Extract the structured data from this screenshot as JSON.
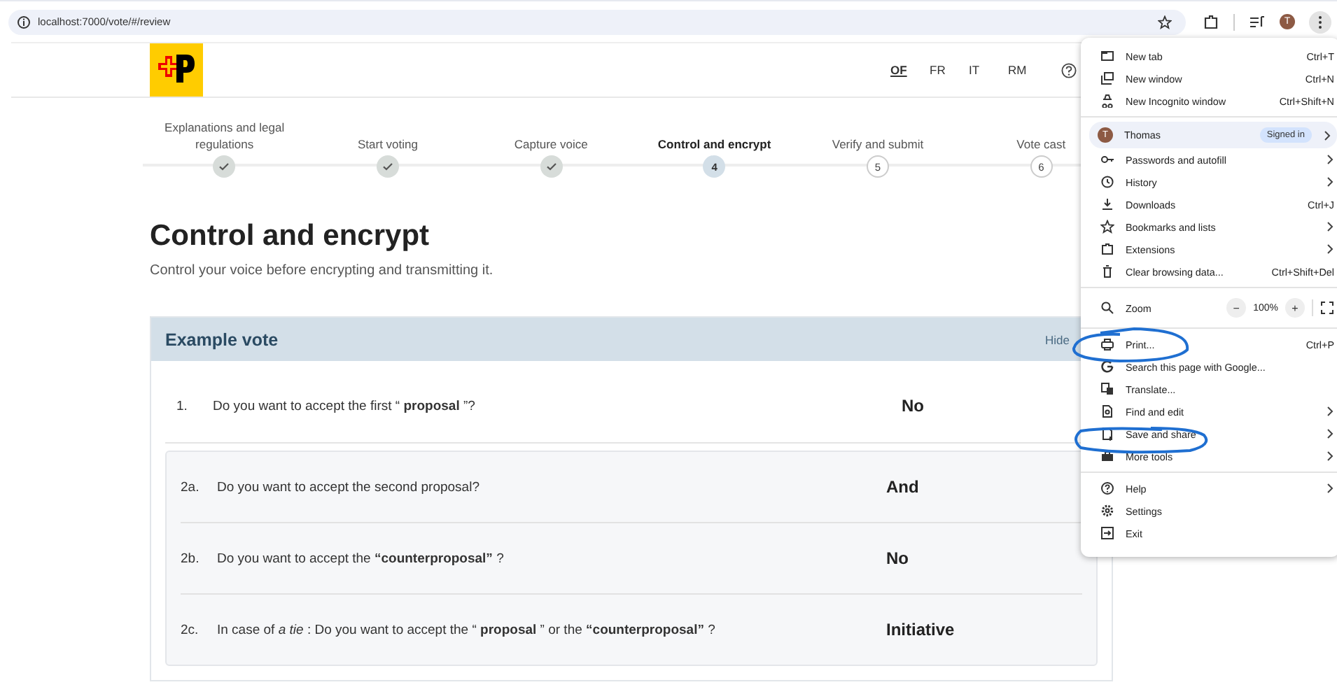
{
  "browser": {
    "url": "localhost:7000/vote/#/review",
    "profile_initial": "T"
  },
  "header": {
    "languages": [
      {
        "label": "OF",
        "selected": true
      },
      {
        "label": "FR",
        "selected": false
      },
      {
        "label": "IT",
        "selected": false
      },
      {
        "label": "RM",
        "selected": false
      }
    ]
  },
  "steps": [
    {
      "label": "Explanations and legal regulations",
      "done": true,
      "selected": false
    },
    {
      "label": "Start voting",
      "done": true,
      "selected": false
    },
    {
      "label": "Capture voice",
      "done": true,
      "selected": false
    },
    {
      "label": "Control and encrypt",
      "number": "4",
      "done": false,
      "selected": true
    },
    {
      "label": "Verify and submit",
      "number": "5",
      "done": false,
      "selected": false
    },
    {
      "label": "Vote cast",
      "number": "6",
      "done": false,
      "selected": false
    }
  ],
  "title": "Control and encrypt",
  "subtitle": "Control your voice before encrypting and transmitting it.",
  "vote": {
    "title": "Example vote",
    "toggle": "Hide",
    "items": [
      {
        "kind": "single",
        "number": "1.",
        "text": "Do you want to accept the first “ **proposal** ”?",
        "answer": "No"
      },
      {
        "kind": "group",
        "questions": [
          {
            "number": "2a.",
            "text": "Do you want to accept the second proposal?",
            "answer": "And"
          },
          {
            "number": "2b.",
            "text": "Do you want to accept the **“counterproposal”** ?",
            "answer": "No"
          },
          {
            "number": "2c.",
            "text": "In case of *a tie* : Do you want to accept the “ **proposal** ” or the **“counterproposal”** ?",
            "answer": "Initiative"
          }
        ]
      }
    ]
  },
  "menu": {
    "sections": [
      [
        {
          "label": "New tab",
          "shortcut": "Ctrl+T"
        },
        {
          "label": "New window",
          "shortcut": "Ctrl+N"
        },
        {
          "label": "New Incognito window",
          "shortcut": "Ctrl+Shift+N"
        }
      ],
      [
        {
          "kind": "profile",
          "initial": "T",
          "label": "Thomas",
          "badge": "Signed in",
          "submenu": true
        },
        {
          "label": "Passwords and autofill",
          "submenu": true
        },
        {
          "label": "History",
          "submenu": true
        },
        {
          "label": "Downloads",
          "shortcut": "Ctrl+J"
        },
        {
          "label": "Bookmarks and lists",
          "submenu": true
        },
        {
          "label": "Extensions",
          "submenu": true
        },
        {
          "label": "Clear browsing data...",
          "shortcut": "Ctrl+Shift+Del"
        }
      ],
      [
        {
          "kind": "zoom",
          "label": "Zoom",
          "minus": "−",
          "value": "100%",
          "plus": "+"
        }
      ],
      [
        {
          "label": "Print...",
          "shortcut": "Ctrl+P"
        },
        {
          "label": "Search this page with Google..."
        },
        {
          "label": "Translate..."
        },
        {
          "label": "Find and edit",
          "submenu": true
        },
        {
          "label": "Save and share",
          "submenu": true
        },
        {
          "label": "More tools",
          "submenu": true
        }
      ],
      [
        {
          "label": "Help",
          "submenu": true
        },
        {
          "label": "Settings"
        },
        {
          "label": "Exit"
        }
      ]
    ]
  }
}
